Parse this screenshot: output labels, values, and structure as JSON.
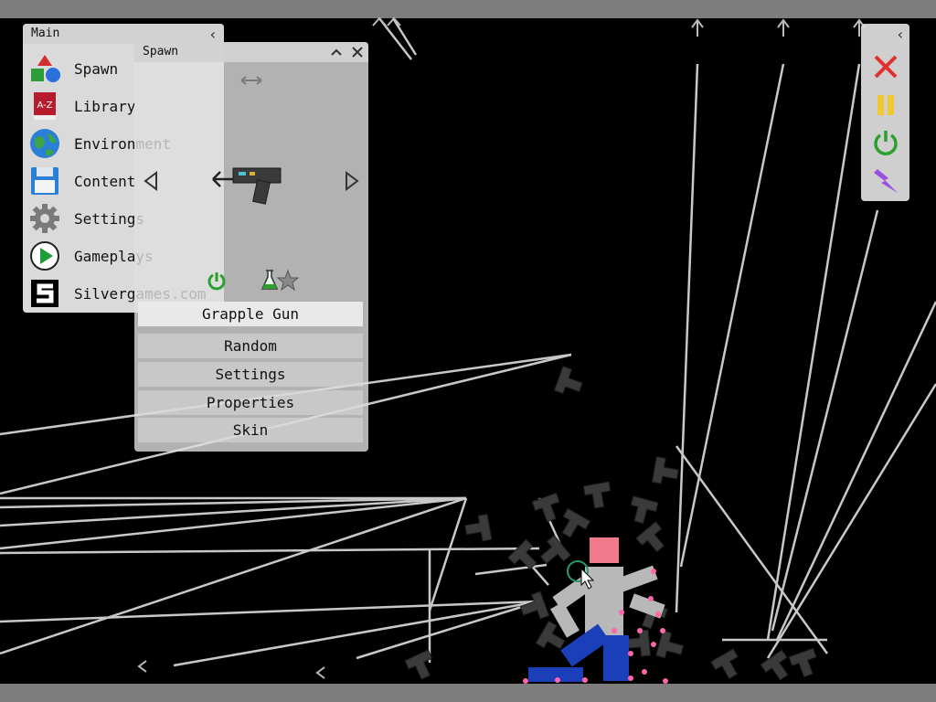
{
  "main_panel": {
    "title": "Main",
    "items": [
      {
        "label": "Spawn",
        "icon": "shapes-icon"
      },
      {
        "label": "Library",
        "icon": "book-icon"
      },
      {
        "label": "Environment",
        "icon": "globe-icon"
      },
      {
        "label": "Content",
        "icon": "floppy-disk-icon"
      },
      {
        "label": "Settings",
        "icon": "gear-icon"
      },
      {
        "label": "Gameplays",
        "icon": "play-icon"
      },
      {
        "label": "Silvergames.com",
        "icon": "silvergames-logo-icon"
      }
    ]
  },
  "spawn_panel": {
    "title": "Spawn",
    "item_name": "Grapple Gun",
    "buttons": [
      "Random",
      "Settings",
      "Properties",
      "Skin"
    ]
  },
  "toolbar": {
    "icons": [
      "close-x-icon",
      "pause-icon",
      "power-icon",
      "lightning-icon"
    ]
  },
  "colors": {
    "panel": "#e8e8e8",
    "header": "#d2d2d2",
    "rope": "#c8c8c8",
    "ragdoll_body": "#b8b8b8",
    "ragdoll_head": "#f07a8a",
    "ragdoll_legs": "#1a3fb8",
    "particles": "#ff66aa",
    "close": "#e03030",
    "pause": "#f0c830",
    "power": "#2ca02c",
    "lightning": "#9b4fe0"
  }
}
